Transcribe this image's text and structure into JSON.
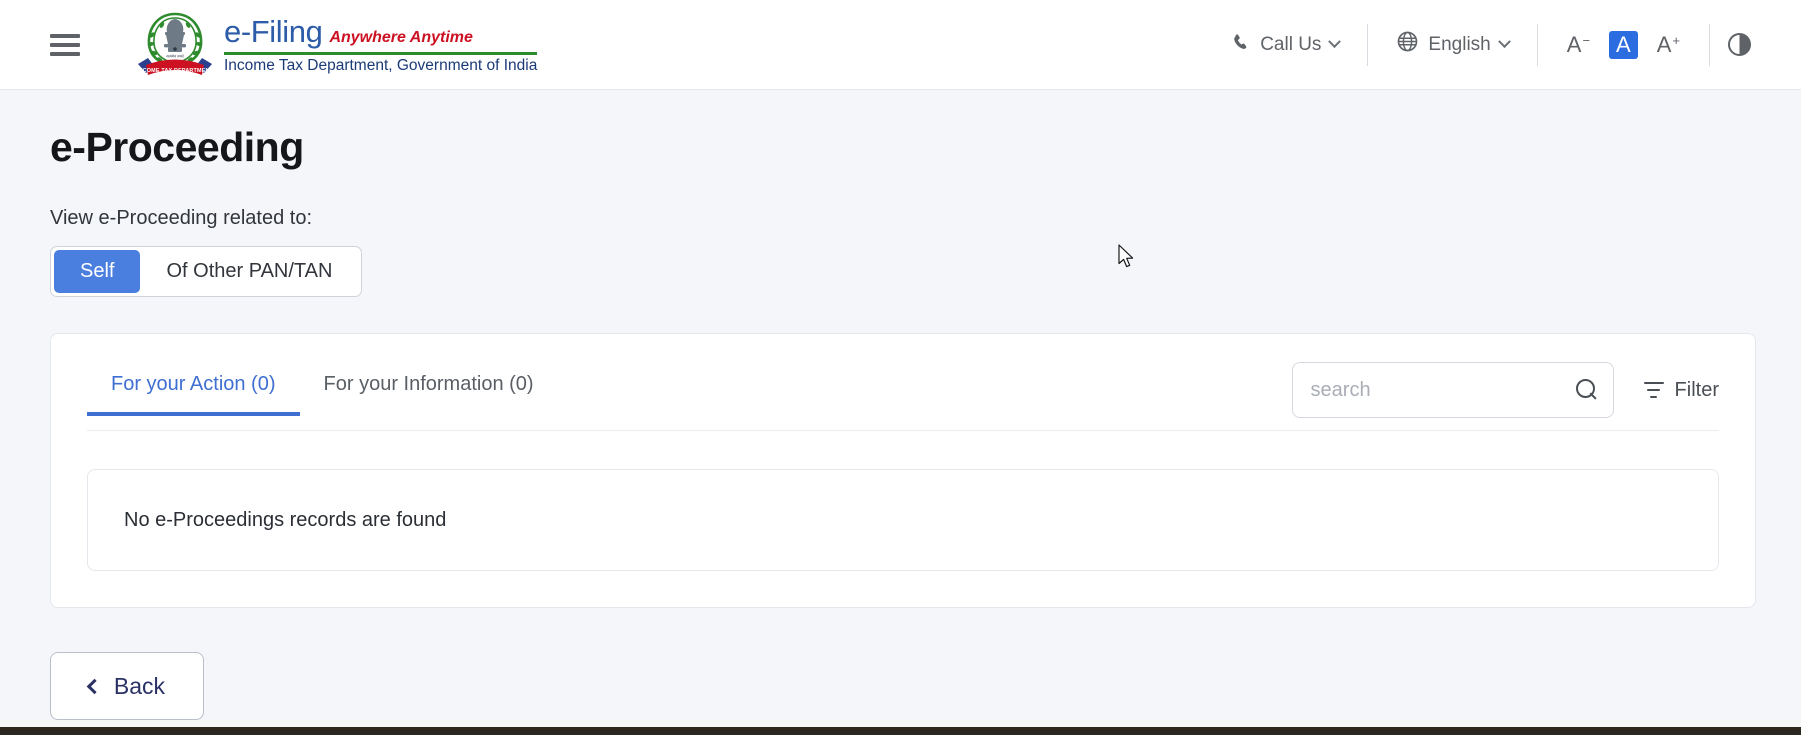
{
  "header": {
    "menu_icon": "hamburger-menu-icon",
    "brand": {
      "emblem_icon": "india-emblem-income-tax-logo",
      "title": "e-Filing",
      "tagline": "Anywhere Anytime",
      "subtitle": "Income Tax Department, Government of India"
    },
    "call_us": {
      "icon": "phone-icon",
      "label": "Call Us"
    },
    "language": {
      "icon": "globe-icon",
      "label": "English"
    },
    "font_size": {
      "decrease": "A",
      "decrease_sup": "−",
      "normal": "A",
      "increase": "A",
      "increase_sup": "+",
      "active": "normal"
    },
    "contrast_icon": "contrast-toggle-icon"
  },
  "main": {
    "page_title": "e-Proceeding",
    "view_label": "View e-Proceeding related to:",
    "toggle": {
      "options": [
        {
          "label": "Self",
          "active": true
        },
        {
          "label": "Of Other PAN/TAN",
          "active": false
        }
      ]
    },
    "tabs": [
      {
        "label": "For your Action (0)",
        "active": true
      },
      {
        "label": "For your Information (0)",
        "active": false
      }
    ],
    "search": {
      "value": "",
      "placeholder": "search",
      "icon": "search-icon"
    },
    "filter": {
      "label": "Filter",
      "icon": "filter-icon"
    },
    "empty_state": {
      "message": "No e-Proceedings records are found"
    },
    "back_button": {
      "label": "Back",
      "icon": "chevron-left-icon"
    }
  },
  "colors": {
    "accent_blue": "#3f6fd1",
    "toggle_active": "#4a7fe0",
    "brand_blue": "#2d5ca8",
    "brand_red": "#cc1122",
    "brand_green": "#2e8b2e",
    "subtitle_navy": "#1b3a78",
    "back_navy": "#2a3164",
    "page_bg": "#f4f6fa"
  }
}
